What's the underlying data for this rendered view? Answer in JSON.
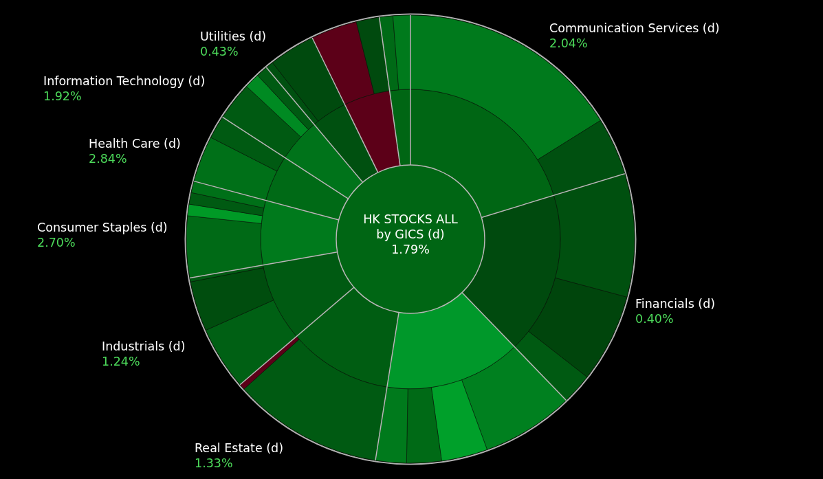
{
  "chart": {
    "center": {
      "title": "HK STOCKS ALL",
      "subtitle": "by GICS (d)",
      "value": "1.79%"
    },
    "sectors": [
      {
        "name": "Communication Services (d)",
        "change": "2.04%"
      },
      {
        "name": "Utilities (d)",
        "change": "0.43%"
      },
      {
        "name": "Information Technology (d)",
        "change": "1.92%"
      },
      {
        "name": "Health Care (d)",
        "change": "2.84%"
      },
      {
        "name": "Consumer Staples (d)",
        "change": "2.70%"
      },
      {
        "name": "Financials (d)",
        "change": "0.40%"
      },
      {
        "name": "Industrials (d)",
        "change": "1.24%"
      },
      {
        "name": "Real Estate (d)",
        "change": "1.33%"
      }
    ]
  }
}
